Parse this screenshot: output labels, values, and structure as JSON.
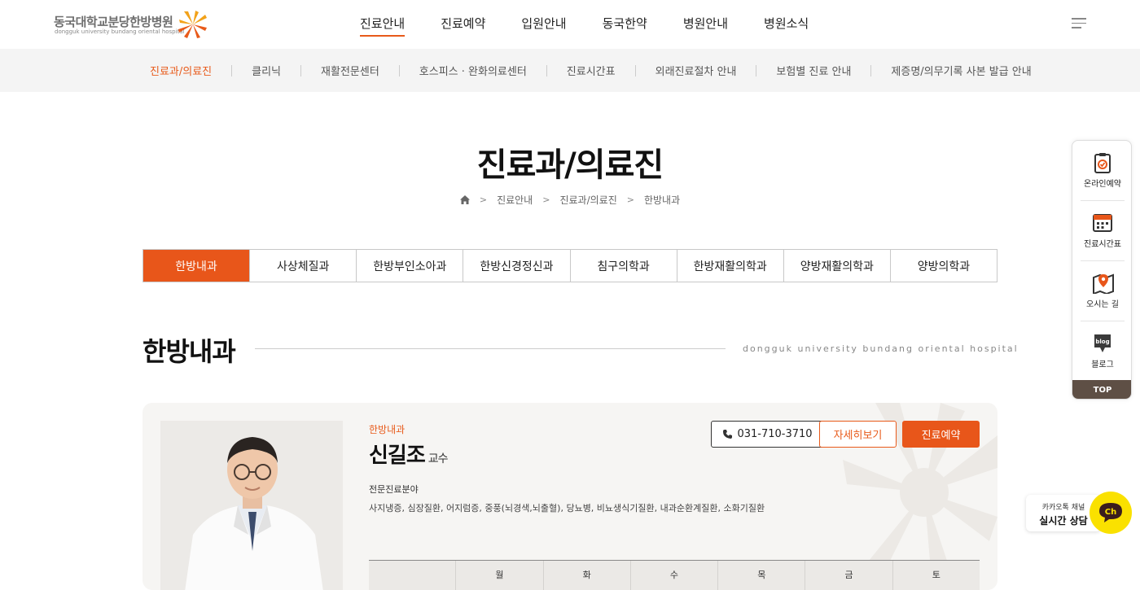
{
  "header": {
    "logo_kr": "동국대학교분당한방병원",
    "logo_en": "dongguk university bundang oriental hospital",
    "gnb": [
      "진료안내",
      "진료예약",
      "입원안내",
      "동국한약",
      "병원안내",
      "병원소식"
    ],
    "gnb_active": 0
  },
  "subnav": {
    "items": [
      "진료과/의료진",
      "클리닉",
      "재활전문센터",
      "호스피스 · 완화의료센터",
      "진료시간표",
      "외래진료절차 안내",
      "보험별 진료 안내",
      "제증명/의무기록 사본 발급 안내"
    ],
    "active": 0
  },
  "page": {
    "title": "진료과/의료진",
    "breadcrumb": [
      "진료안내",
      "진료과/의료진",
      "한방내과"
    ]
  },
  "tabs": {
    "items": [
      "한방내과",
      "사상체질과",
      "한방부인소아과",
      "한방신경정신과",
      "침구의학과",
      "한방재활의학과",
      "양방재활의학과",
      "양방의학과"
    ],
    "active": 0
  },
  "section": {
    "title": "한방내과",
    "subtitle_en": "dongguk university bundang oriental hospital"
  },
  "doctor": {
    "dept": "한방내과",
    "name": "신길조",
    "title": "교수",
    "spec_label": "전문진료분야",
    "spec_text": "사지냉증, 심장질환, 어지럼증, 중풍(뇌경색,뇌출혈), 당뇨병, 비뇨생식기질환, 내과순환계질환, 소화기질환",
    "phone": "031-710-3710",
    "detail_label": "자세히보기",
    "reserve_label": "진료예약",
    "schedule_days": [
      "",
      "월",
      "화",
      "수",
      "목",
      "금",
      "토"
    ]
  },
  "quick_menu": {
    "items": [
      "온라인예약",
      "진료시간표",
      "오시는 길",
      "블로그"
    ],
    "blog_icon_text": "blog",
    "top_label": "TOP"
  },
  "kakao": {
    "line1": "카카오톡 채널",
    "line2": "실시간 상담",
    "icon_text": "Ch"
  },
  "colors": {
    "accent": "#e8561a",
    "kakao": "#fae100",
    "top_bg": "#5e4f45"
  }
}
